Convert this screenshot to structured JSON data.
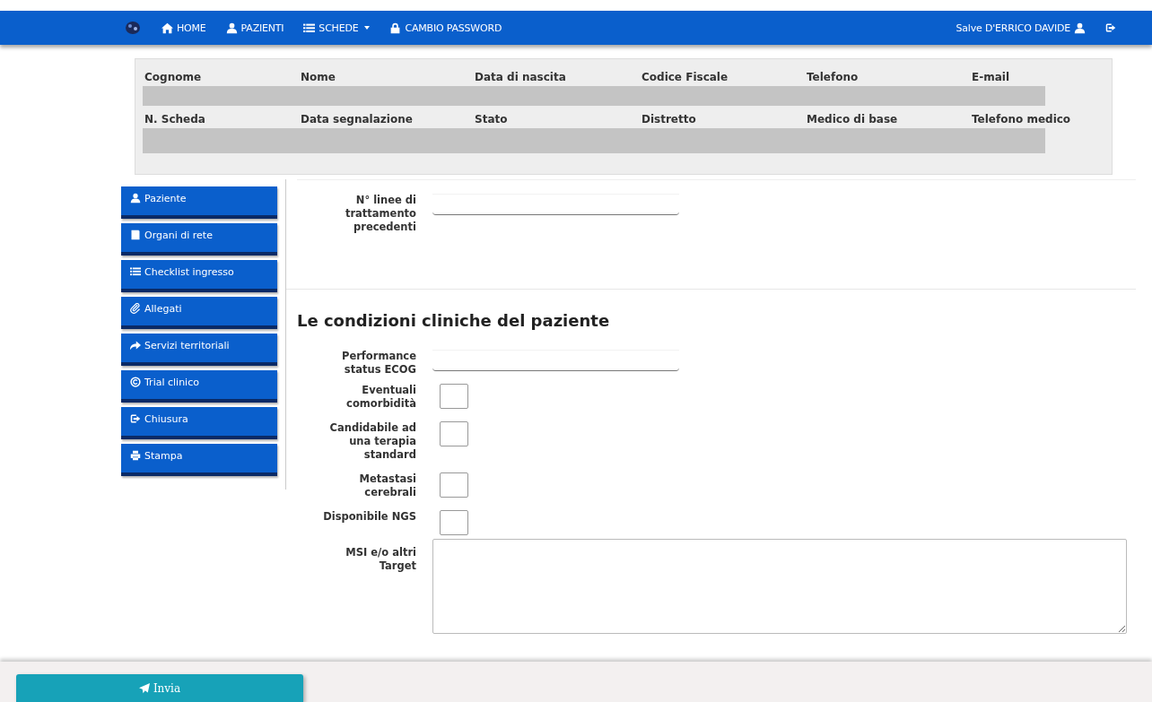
{
  "navbar": {
    "items": [
      {
        "label": "HOME"
      },
      {
        "label": "PAZIENTI"
      },
      {
        "label": "SCHEDE"
      },
      {
        "label": "CAMBIO PASSWORD"
      }
    ],
    "greeting": "Salve D'ERRICO DAVIDE"
  },
  "patient_panel": {
    "rows": [
      {
        "columns": [
          "Cognome",
          "Nome",
          "Data di nascita",
          "Codice Fiscale",
          "Telefono",
          "E-mail"
        ]
      },
      {
        "columns": [
          "N. Scheda",
          "Data segnalazione",
          "Stato",
          "Distretto",
          "Medico di base",
          "Telefono medico"
        ]
      }
    ]
  },
  "sidebar": {
    "items": [
      {
        "label": "Paziente"
      },
      {
        "label": "Organi di rete"
      },
      {
        "label": "Checklist ingresso"
      },
      {
        "label": "Allegati"
      },
      {
        "label": "Servizi territoriali"
      },
      {
        "label": "Trial clinico"
      },
      {
        "label": "Chiusura"
      },
      {
        "label": "Stampa"
      }
    ]
  },
  "form": {
    "fields": [
      {
        "kind": "text",
        "label": "N° linee di trattamento precedenti"
      }
    ],
    "section_title": "Le condizioni cliniche del paziente",
    "section_fields": [
      {
        "kind": "text",
        "label": "Performance status ECOG"
      },
      {
        "kind": "checkbox",
        "label": "Eventuali comorbidità",
        "checked": false
      },
      {
        "kind": "checkbox",
        "label": "Candidabile ad una terapia standard",
        "checked": false
      },
      {
        "kind": "checkbox",
        "label": "Metastasi cerebrali",
        "checked": false
      },
      {
        "kind": "checkbox",
        "label": "Disponibile NGS",
        "checked": false
      },
      {
        "kind": "textarea",
        "label": "MSI e/o altri Target"
      }
    ]
  },
  "footer": {
    "submit": "Invia"
  }
}
